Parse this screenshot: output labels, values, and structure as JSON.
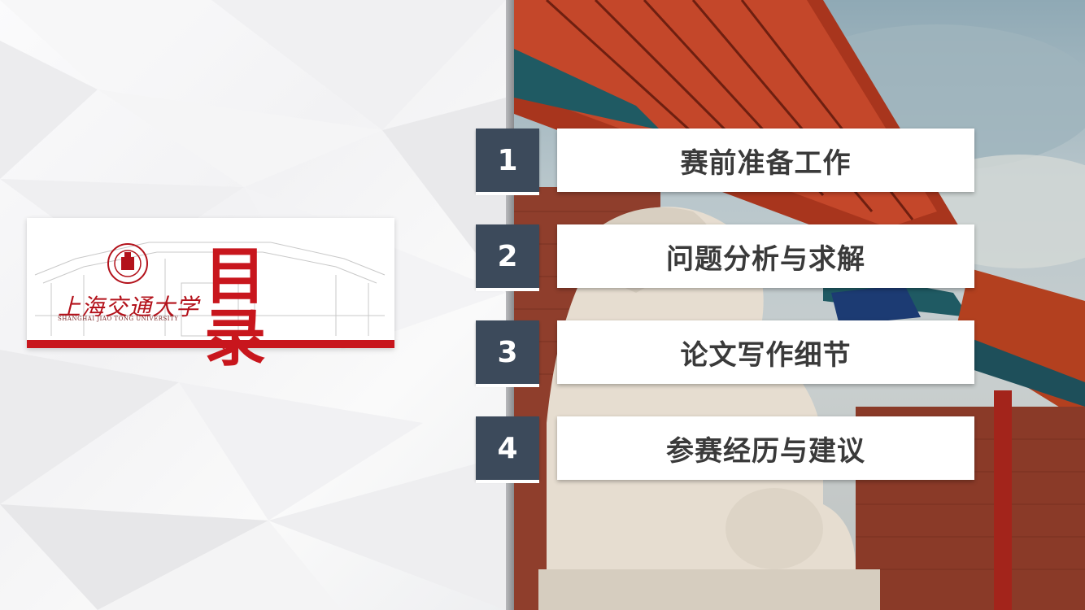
{
  "title_card": {
    "title": "目 录",
    "logo_text": "上海交通大学",
    "logo_sub": "SHANGHAI JIAO TONG UNIVERSITY"
  },
  "menu": [
    {
      "number": "1",
      "label": "赛前准备工作"
    },
    {
      "number": "2",
      "label": "问题分析与求解"
    },
    {
      "number": "3",
      "label": "论文写作细节"
    },
    {
      "number": "4",
      "label": "参赛经历与建议"
    }
  ],
  "colors": {
    "accent_red": "#c8161d",
    "number_box": "#3c4a5b",
    "label_text": "#3a3a3a"
  }
}
